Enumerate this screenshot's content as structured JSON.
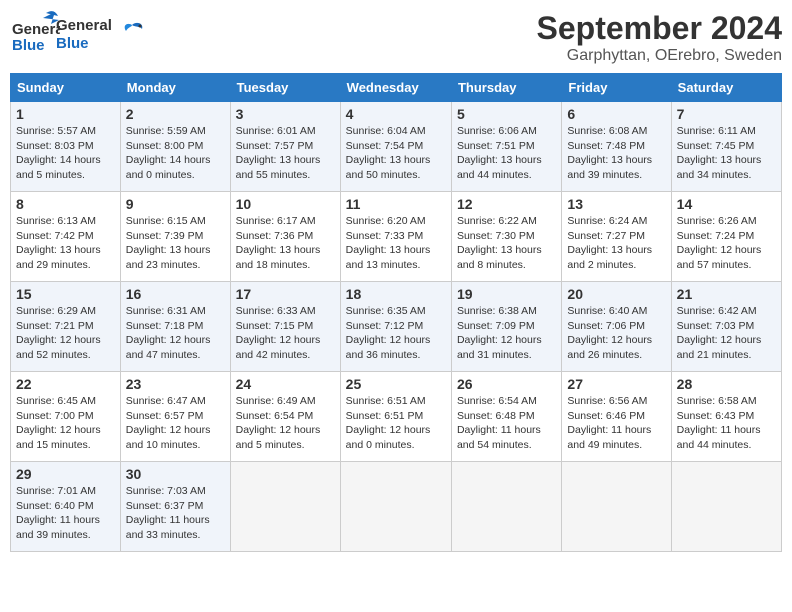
{
  "header": {
    "logo_line1": "General",
    "logo_line2": "Blue",
    "main_title": "September 2024",
    "sub_title": "Garphyttan, OErebro, Sweden"
  },
  "calendar": {
    "days_of_week": [
      "Sunday",
      "Monday",
      "Tuesday",
      "Wednesday",
      "Thursday",
      "Friday",
      "Saturday"
    ],
    "weeks": [
      [
        {
          "day": "1",
          "info": "Sunrise: 5:57 AM\nSunset: 8:03 PM\nDaylight: 14 hours\nand 5 minutes."
        },
        {
          "day": "2",
          "info": "Sunrise: 5:59 AM\nSunset: 8:00 PM\nDaylight: 14 hours\nand 0 minutes."
        },
        {
          "day": "3",
          "info": "Sunrise: 6:01 AM\nSunset: 7:57 PM\nDaylight: 13 hours\nand 55 minutes."
        },
        {
          "day": "4",
          "info": "Sunrise: 6:04 AM\nSunset: 7:54 PM\nDaylight: 13 hours\nand 50 minutes."
        },
        {
          "day": "5",
          "info": "Sunrise: 6:06 AM\nSunset: 7:51 PM\nDaylight: 13 hours\nand 44 minutes."
        },
        {
          "day": "6",
          "info": "Sunrise: 6:08 AM\nSunset: 7:48 PM\nDaylight: 13 hours\nand 39 minutes."
        },
        {
          "day": "7",
          "info": "Sunrise: 6:11 AM\nSunset: 7:45 PM\nDaylight: 13 hours\nand 34 minutes."
        }
      ],
      [
        {
          "day": "8",
          "info": "Sunrise: 6:13 AM\nSunset: 7:42 PM\nDaylight: 13 hours\nand 29 minutes."
        },
        {
          "day": "9",
          "info": "Sunrise: 6:15 AM\nSunset: 7:39 PM\nDaylight: 13 hours\nand 23 minutes."
        },
        {
          "day": "10",
          "info": "Sunrise: 6:17 AM\nSunset: 7:36 PM\nDaylight: 13 hours\nand 18 minutes."
        },
        {
          "day": "11",
          "info": "Sunrise: 6:20 AM\nSunset: 7:33 PM\nDaylight: 13 hours\nand 13 minutes."
        },
        {
          "day": "12",
          "info": "Sunrise: 6:22 AM\nSunset: 7:30 PM\nDaylight: 13 hours\nand 8 minutes."
        },
        {
          "day": "13",
          "info": "Sunrise: 6:24 AM\nSunset: 7:27 PM\nDaylight: 13 hours\nand 2 minutes."
        },
        {
          "day": "14",
          "info": "Sunrise: 6:26 AM\nSunset: 7:24 PM\nDaylight: 12 hours\nand 57 minutes."
        }
      ],
      [
        {
          "day": "15",
          "info": "Sunrise: 6:29 AM\nSunset: 7:21 PM\nDaylight: 12 hours\nand 52 minutes."
        },
        {
          "day": "16",
          "info": "Sunrise: 6:31 AM\nSunset: 7:18 PM\nDaylight: 12 hours\nand 47 minutes."
        },
        {
          "day": "17",
          "info": "Sunrise: 6:33 AM\nSunset: 7:15 PM\nDaylight: 12 hours\nand 42 minutes."
        },
        {
          "day": "18",
          "info": "Sunrise: 6:35 AM\nSunset: 7:12 PM\nDaylight: 12 hours\nand 36 minutes."
        },
        {
          "day": "19",
          "info": "Sunrise: 6:38 AM\nSunset: 7:09 PM\nDaylight: 12 hours\nand 31 minutes."
        },
        {
          "day": "20",
          "info": "Sunrise: 6:40 AM\nSunset: 7:06 PM\nDaylight: 12 hours\nand 26 minutes."
        },
        {
          "day": "21",
          "info": "Sunrise: 6:42 AM\nSunset: 7:03 PM\nDaylight: 12 hours\nand 21 minutes."
        }
      ],
      [
        {
          "day": "22",
          "info": "Sunrise: 6:45 AM\nSunset: 7:00 PM\nDaylight: 12 hours\nand 15 minutes."
        },
        {
          "day": "23",
          "info": "Sunrise: 6:47 AM\nSunset: 6:57 PM\nDaylight: 12 hours\nand 10 minutes."
        },
        {
          "day": "24",
          "info": "Sunrise: 6:49 AM\nSunset: 6:54 PM\nDaylight: 12 hours\nand 5 minutes."
        },
        {
          "day": "25",
          "info": "Sunrise: 6:51 AM\nSunset: 6:51 PM\nDaylight: 12 hours\nand 0 minutes."
        },
        {
          "day": "26",
          "info": "Sunrise: 6:54 AM\nSunset: 6:48 PM\nDaylight: 11 hours\nand 54 minutes."
        },
        {
          "day": "27",
          "info": "Sunrise: 6:56 AM\nSunset: 6:46 PM\nDaylight: 11 hours\nand 49 minutes."
        },
        {
          "day": "28",
          "info": "Sunrise: 6:58 AM\nSunset: 6:43 PM\nDaylight: 11 hours\nand 44 minutes."
        }
      ],
      [
        {
          "day": "29",
          "info": "Sunrise: 7:01 AM\nSunset: 6:40 PM\nDaylight: 11 hours\nand 39 minutes."
        },
        {
          "day": "30",
          "info": "Sunrise: 7:03 AM\nSunset: 6:37 PM\nDaylight: 11 hours\nand 33 minutes."
        },
        {
          "day": "",
          "info": ""
        },
        {
          "day": "",
          "info": ""
        },
        {
          "day": "",
          "info": ""
        },
        {
          "day": "",
          "info": ""
        },
        {
          "day": "",
          "info": ""
        }
      ]
    ]
  }
}
